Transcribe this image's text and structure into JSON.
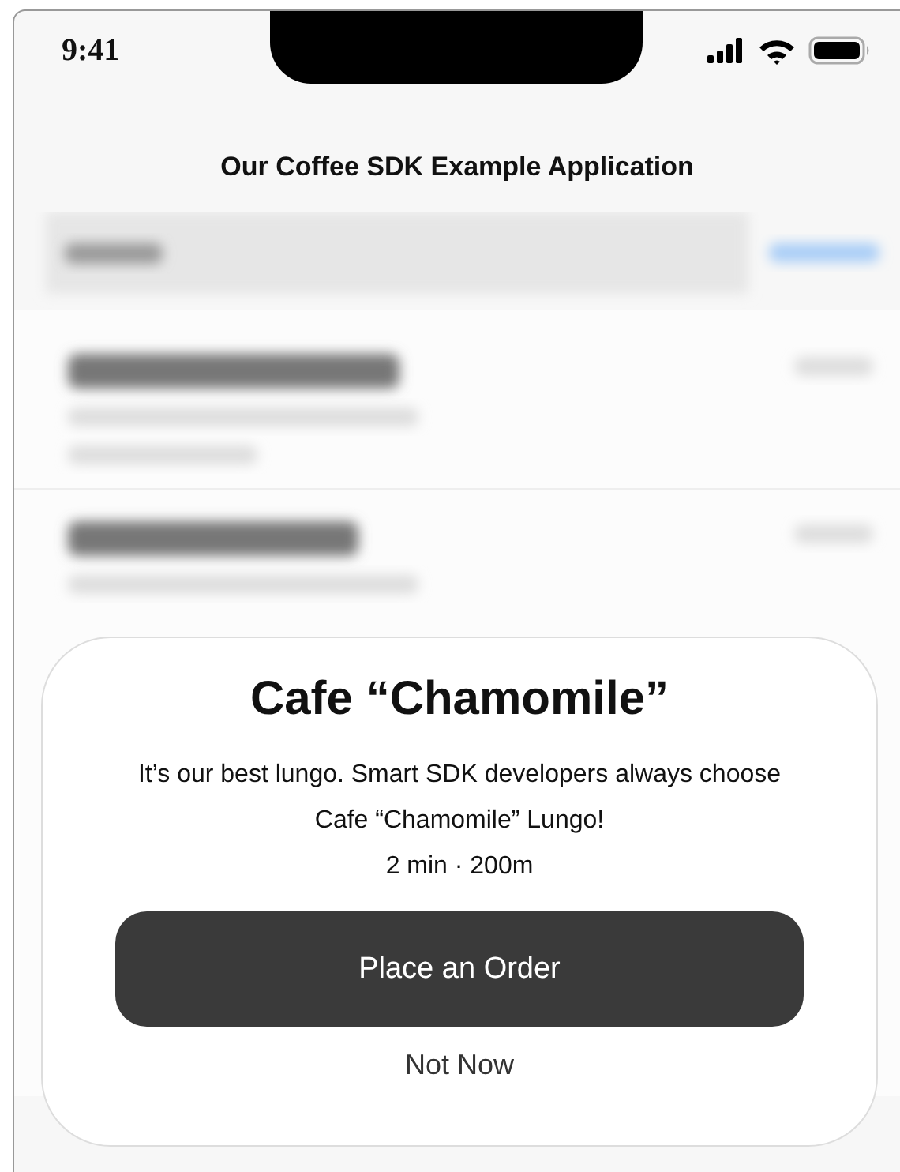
{
  "status_bar": {
    "time": "9:41"
  },
  "header": {
    "title": "Our Coffee SDK Example Application"
  },
  "popup": {
    "title": "Cafe “Chamomile”",
    "message": "It’s our best lungo. Smart SDK developers always choose Cafe “Chamomile” Lungo!",
    "details": "2 min · 200m",
    "primary_button": "Place an Order",
    "secondary_button": "Not Now"
  }
}
